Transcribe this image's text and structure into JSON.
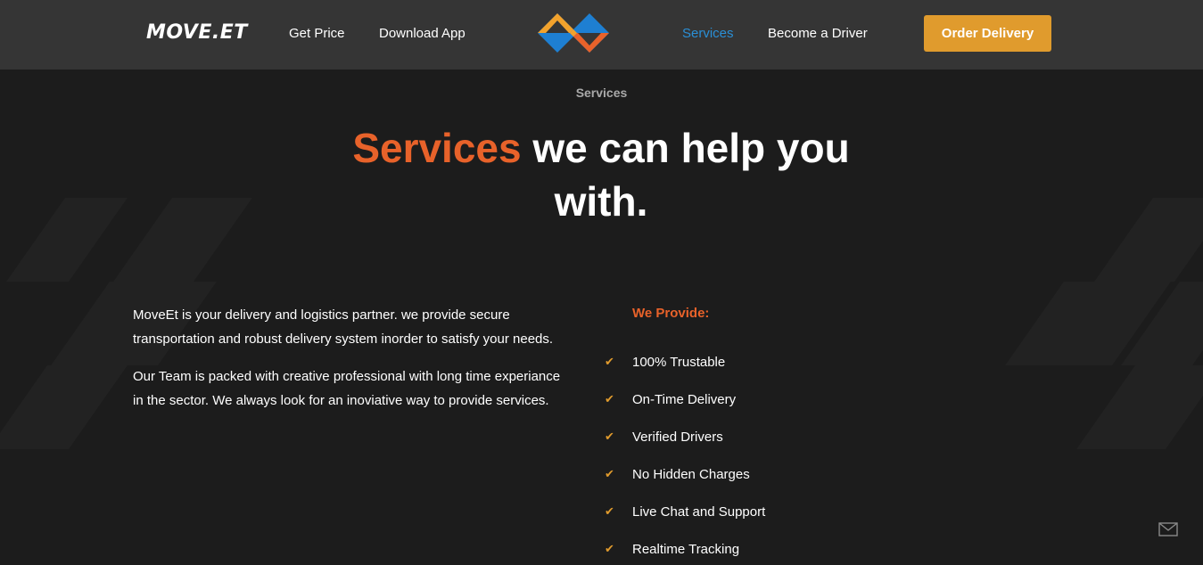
{
  "header": {
    "logo": "MOVE.ET",
    "nav_left": [
      {
        "label": "Get Price"
      },
      {
        "label": "Download App"
      }
    ],
    "nav_right": [
      {
        "label": "Services",
        "active": true
      },
      {
        "label": "Become a Driver"
      }
    ],
    "cta_label": "Order Delivery",
    "brand_icon": "diamond-logo-icon"
  },
  "hero": {
    "eyebrow": "Services",
    "title_accent": "Services",
    "title_rest": " we can help you with."
  },
  "about": {
    "paragraphs": [
      "MoveEt is your delivery and logistics partner. we provide secure transportation and robust delivery system inorder to satisfy your needs.",
      "Our Team is packed with creative professional with long time experiance in the sector. We always look for an inoviative way to provide services."
    ]
  },
  "provide": {
    "heading": "We Provide:",
    "check_icon": "check-icon",
    "items": [
      "100% Trustable",
      "On-Time Delivery",
      "Verified Drivers",
      "No Hidden Charges",
      "Live Chat and Support",
      "Realtime Tracking"
    ]
  },
  "floating": {
    "mail_icon": "mail-icon"
  },
  "colors": {
    "navbar": "#353535",
    "background": "#1c1c1c",
    "accent_orange": "#e8622a",
    "button_gold": "#e09b2d",
    "active_link_blue": "#2a8fd6"
  }
}
